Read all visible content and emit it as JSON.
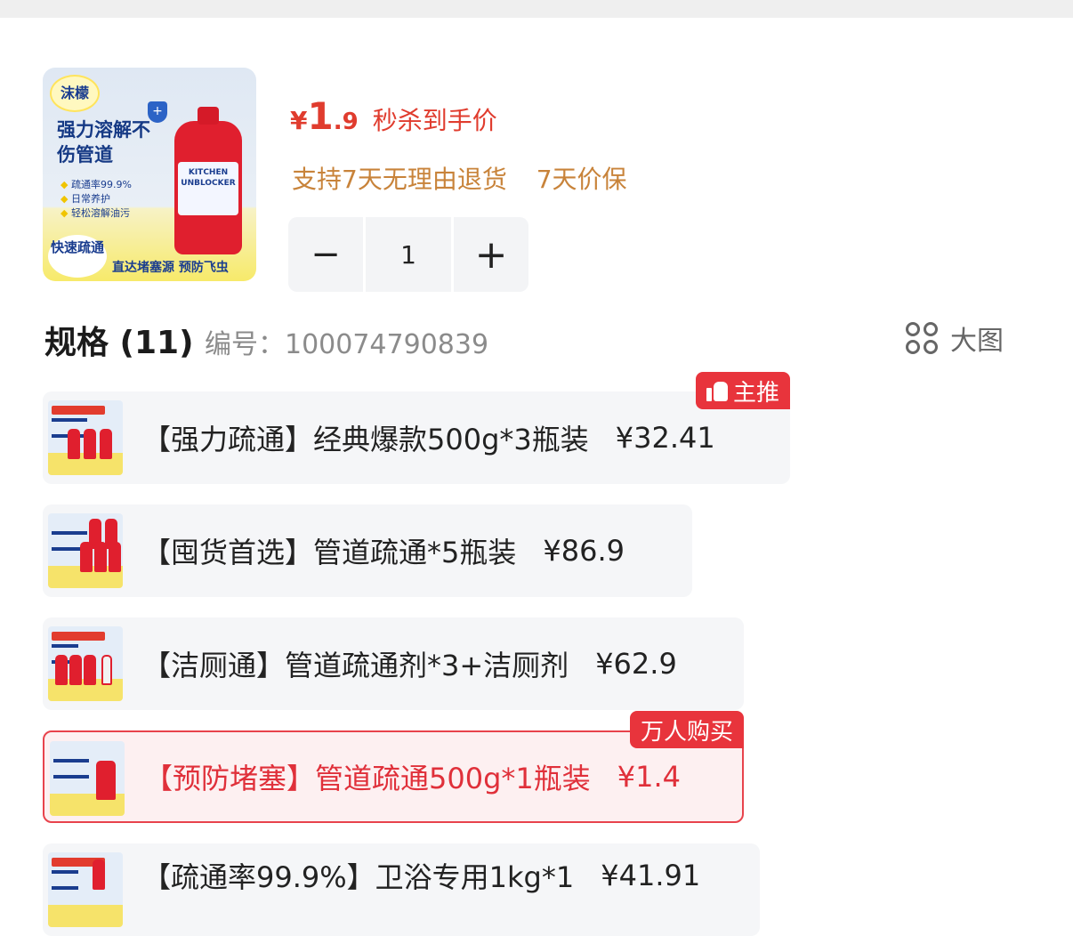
{
  "product": {
    "image": {
      "brand": "沫檬",
      "headline": "强力溶解不伤管道",
      "bullets": [
        "疏通率99.9%",
        "日常养护",
        "轻松溶解油污"
      ],
      "bottle_label": "KITCHEN UNBLOCKER",
      "badge": "快速疏通",
      "slogan": "直达堵塞源 预防飞虫"
    },
    "price_symbol": "¥",
    "price_int": "1",
    "price_dec": ".9",
    "price_text": "秒杀到手价",
    "guarantees": [
      "支持7天无理由退货",
      "7天价保"
    ],
    "quantity": "1",
    "minus_label": "−",
    "plus_label": "+"
  },
  "spec": {
    "title": "规格 (11)",
    "code_label": "编号：",
    "code_value": "100074790839",
    "big_view_label": "大图",
    "options": [
      {
        "name": "【强力疏通】经典爆款500g*3瓶装",
        "price": "¥32.41",
        "tag": "主推",
        "selected": false
      },
      {
        "name": "【囤货首选】管道疏通*5瓶装",
        "price": "¥86.9",
        "tag": "",
        "selected": false
      },
      {
        "name": "【洁厕通】管道疏通剂*3+洁厕剂",
        "price": "¥62.9",
        "tag": "",
        "selected": false
      },
      {
        "name": "【预防堵塞】管道疏通500g*1瓶装",
        "price": "¥1.4",
        "tag": "万人购买",
        "selected": true
      },
      {
        "name": "【疏通率99.9%】卫浴专用1kg*1",
        "price": "¥41.91",
        "tag": "",
        "selected": false
      }
    ]
  },
  "colors": {
    "accent_red": "#e8343c",
    "price_red": "#e03c2e",
    "guarantee_orange": "#c8833a"
  }
}
